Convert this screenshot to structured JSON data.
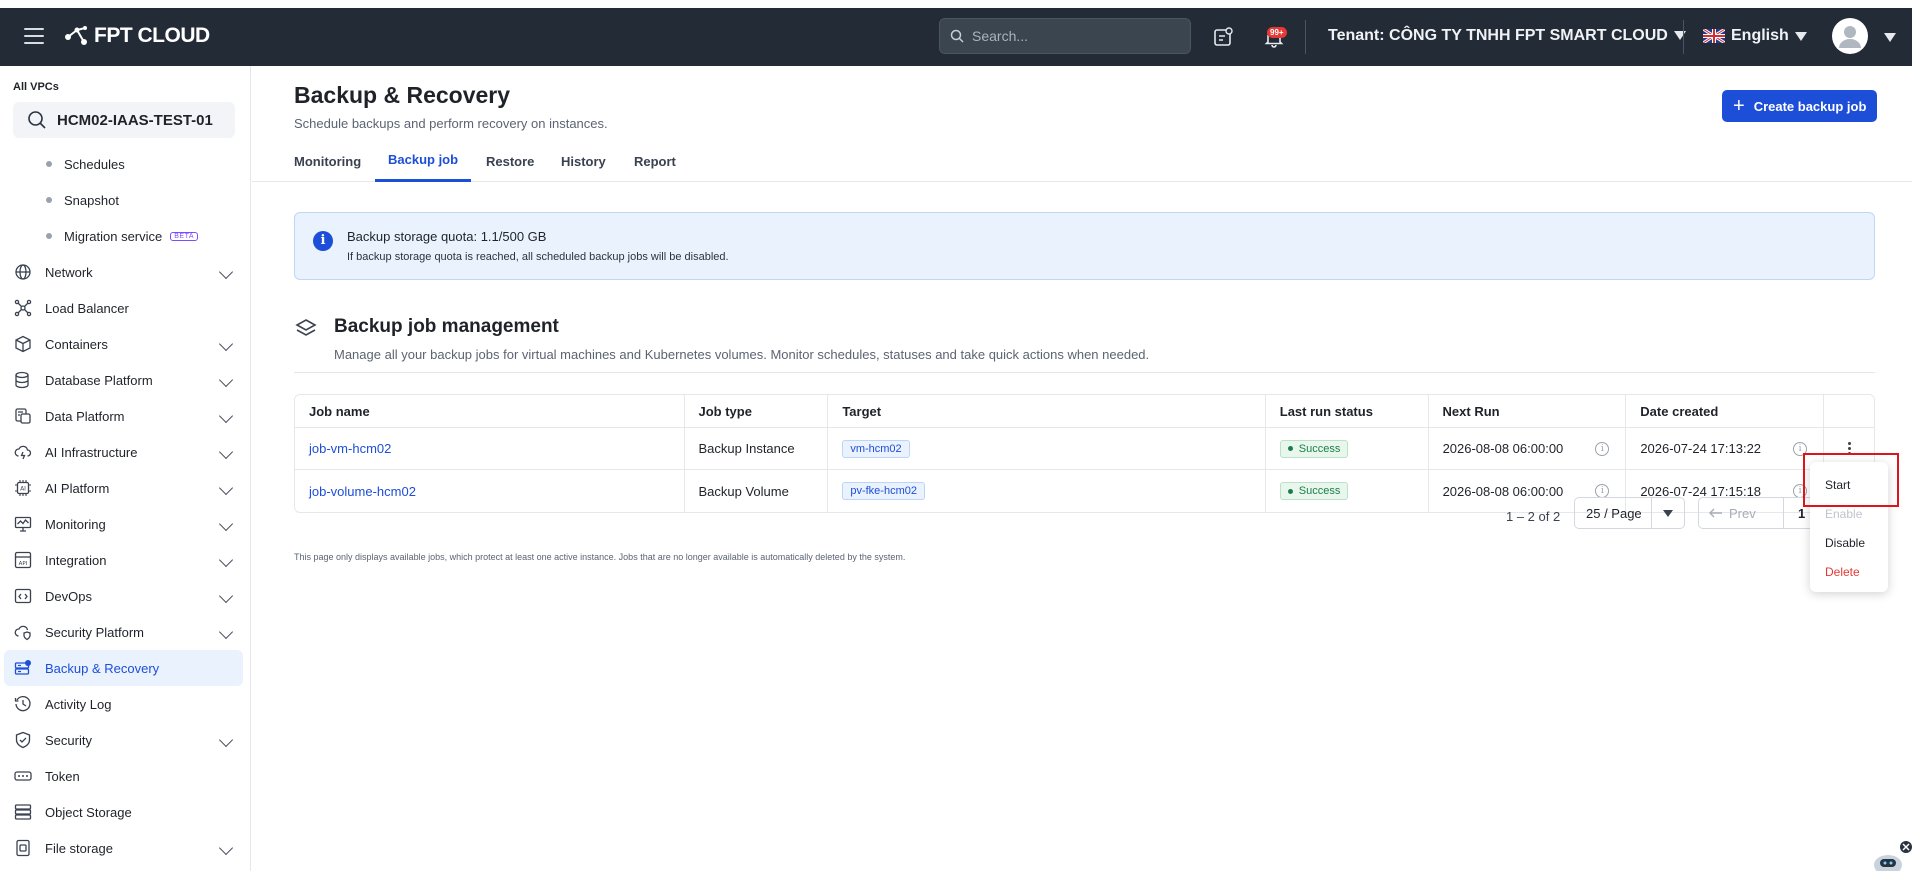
{
  "header": {
    "brand": "FPT CLOUD",
    "search_placeholder": "Search...",
    "notification_badge": "99+",
    "tenant": "Tenant:  CÔNG TY TNHH FPT SMART CLOUD",
    "language": "English"
  },
  "sidebar": {
    "vpc_title": "All VPCs",
    "vpc_name": "HCM02-IAAS-TEST-01",
    "sub_items": [
      {
        "label": "Schedules"
      },
      {
        "label": "Snapshot"
      },
      {
        "label": "Migration service",
        "badge": "BETA"
      }
    ],
    "items": [
      {
        "label": "Network",
        "icon": "globe-icon",
        "expandable": true
      },
      {
        "label": "Load Balancer",
        "icon": "load-balancer-icon",
        "expandable": false
      },
      {
        "label": "Containers",
        "icon": "cube-icon",
        "expandable": true
      },
      {
        "label": "Database Platform",
        "icon": "database-icon",
        "expandable": true
      },
      {
        "label": "Data Platform",
        "icon": "data-platform-icon",
        "expandable": true
      },
      {
        "label": "AI Infrastructure",
        "icon": "cloud-ai-icon",
        "expandable": true
      },
      {
        "label": "AI Platform",
        "icon": "ai-chip-icon",
        "expandable": true
      },
      {
        "label": "Monitoring",
        "icon": "monitor-icon",
        "expandable": true
      },
      {
        "label": "Integration",
        "icon": "api-icon",
        "expandable": true
      },
      {
        "label": "DevOps",
        "icon": "code-icon",
        "expandable": true
      },
      {
        "label": "Security Platform",
        "icon": "shield-cloud-icon",
        "expandable": true
      },
      {
        "label": "Backup & Recovery",
        "icon": "backup-icon",
        "expandable": false,
        "active": true
      },
      {
        "label": "Activity Log",
        "icon": "clock-icon",
        "expandable": false
      },
      {
        "label": "Security",
        "icon": "shield-icon",
        "expandable": true
      },
      {
        "label": "Token",
        "icon": "token-icon",
        "expandable": false
      },
      {
        "label": "Object Storage",
        "icon": "storage-icon",
        "expandable": false
      },
      {
        "label": "File storage",
        "icon": "file-icon",
        "expandable": true
      }
    ]
  },
  "page": {
    "title": "Backup & Recovery",
    "subtitle": "Schedule backups and perform recovery on instances.",
    "create_button": "Create backup job",
    "tabs": [
      "Monitoring",
      "Backup job",
      "Restore",
      "History",
      "Report"
    ],
    "active_tab": "Backup job"
  },
  "info": {
    "title": "Backup storage quota: 1.1/500 GB",
    "text": "If backup storage quota is reached, all scheduled backup jobs will be disabled."
  },
  "section": {
    "title": "Backup job management",
    "subtitle": "Manage all your backup jobs for virtual machines and Kubernetes volumes. Monitor schedules, statuses and take quick actions when needed."
  },
  "table": {
    "headers": [
      "Job name",
      "Job type",
      "Target",
      "Last run status",
      "Next Run",
      "Date created"
    ],
    "rows": [
      {
        "job_name": "job-vm-hcm02",
        "job_type": "Backup Instance",
        "target": "vm-hcm02",
        "status": "Success",
        "next_run": "2026-08-08 06:00:00",
        "created": "2026-07-24 17:13:22"
      },
      {
        "job_name": "job-volume-hcm02",
        "job_type": "Backup Volume",
        "target": "pv-fke-hcm02",
        "status": "Success",
        "next_run": "2026-08-08 06:00:00",
        "created": "2026-07-24 17:15:18"
      }
    ]
  },
  "pagination": {
    "range": "1 – 2 of 2",
    "page_size": "25 / Page",
    "prev": "Prev",
    "current": "1"
  },
  "footnote": "This page only displays available jobs, which protect at least one active instance. Jobs that are no longer available is automatically deleted by the system.",
  "action_menu": {
    "items": [
      "Start",
      "Enable",
      "Disable",
      "Delete"
    ]
  },
  "colors": {
    "topbar": "#222b36",
    "primary": "#1d4ed8",
    "success": "#1a7f45",
    "danger": "#e53935",
    "highlight": "#e0131b"
  }
}
